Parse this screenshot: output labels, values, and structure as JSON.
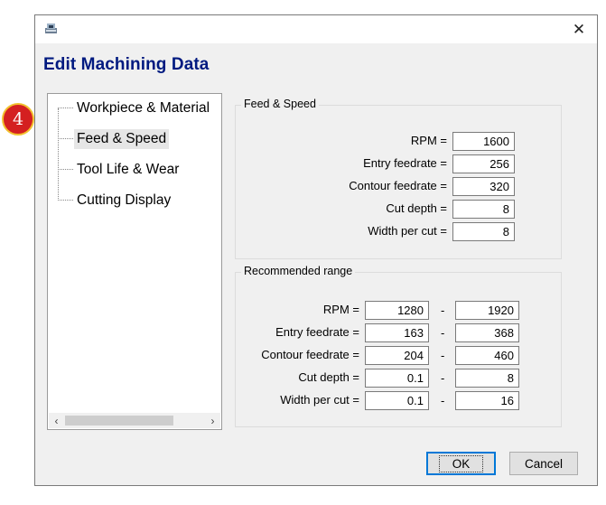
{
  "window": {
    "title": "",
    "heading": "Edit Machining Data",
    "close_glyph": "✕"
  },
  "tree": {
    "items": [
      {
        "label": "Workpiece & Material",
        "selected": false
      },
      {
        "label": "Feed & Speed",
        "selected": true
      },
      {
        "label": "Tool Life & Wear",
        "selected": false
      },
      {
        "label": "Cutting Display",
        "selected": false
      }
    ],
    "scroll_left": "‹",
    "scroll_right": "›"
  },
  "feed_speed": {
    "title": "Feed & Speed",
    "rows": [
      {
        "label": "RPM =",
        "value": "1600"
      },
      {
        "label": "Entry feedrate =",
        "value": "256"
      },
      {
        "label": "Contour feedrate =",
        "value": "320"
      },
      {
        "label": "Cut depth =",
        "value": "8"
      },
      {
        "label": "Width per cut =",
        "value": "8"
      }
    ]
  },
  "recommended": {
    "title": "Recommended range",
    "separator": "-",
    "rows": [
      {
        "label": "RPM =",
        "min": "1280",
        "max": "1920"
      },
      {
        "label": "Entry feedrate =",
        "min": "163",
        "max": "368"
      },
      {
        "label": "Contour feedrate =",
        "min": "204",
        "max": "460"
      },
      {
        "label": "Cut depth =",
        "min": "0.1",
        "max": "8"
      },
      {
        "label": "Width per cut =",
        "min": "0.1",
        "max": "16"
      }
    ]
  },
  "buttons": {
    "ok": "OK",
    "cancel": "Cancel"
  },
  "annotation": {
    "step": "4"
  },
  "colors": {
    "heading": "#001a80",
    "badge_fill": "#d42020",
    "badge_ring": "#f2c12e",
    "focus": "#0078d7"
  }
}
